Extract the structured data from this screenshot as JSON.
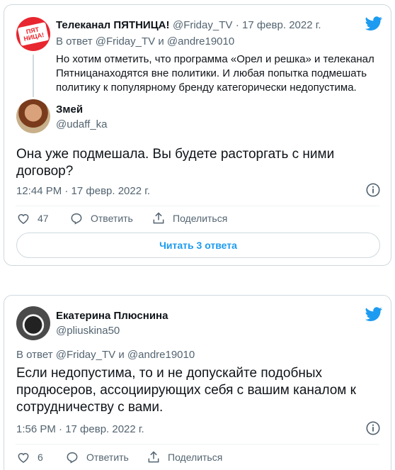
{
  "colors": {
    "accent": "#1d9bf0",
    "muted": "#536471",
    "text": "#0f1419",
    "border": "#cfd9de"
  },
  "card1": {
    "parent": {
      "author_name": "Телеканал ПЯТНИЦА!",
      "handle": "@Friday_TV",
      "date": "· 17 февр. 2022 г.",
      "avatar_text_1": "ПЯТ",
      "avatar_text_2": "НИЦА!",
      "reply_prefix": "В ответ",
      "reply_user1": "@Friday_TV",
      "reply_and": "и",
      "reply_user2": "@andre19010",
      "text": "Но хотим отметить, что программа «Орел и решка» и телеканал Пятницанаходятся вне политики. И любая попытка подмешать политику к популярному бренду категорически недопустима."
    },
    "tweet": {
      "author_name": "Змей",
      "handle": "@udaff_ka",
      "text": "Она уже подмешала. Вы будете расторгать с ними договор?",
      "time": "12:44 PM · 17 февр. 2022 г.",
      "likes": "47",
      "reply_label": "Ответить",
      "share_label": "Поделиться"
    },
    "replies_button": "Читать 3 ответа"
  },
  "card2": {
    "tweet": {
      "author_name": "Екатерина Плюснина",
      "handle": "@pliuskina50",
      "reply_prefix": "В ответ",
      "reply_user1": "@Friday_TV",
      "reply_and": "и",
      "reply_user2": "@andre19010",
      "text": "Если недопустима, то и не допускайте подобных продюсеров, ассоциирующих себя с вашим каналом к сотрудничеству с вами.",
      "time": "1:56 PM · 17 февр. 2022 г.",
      "likes": "6",
      "reply_label": "Ответить",
      "share_label": "Поделиться"
    }
  }
}
